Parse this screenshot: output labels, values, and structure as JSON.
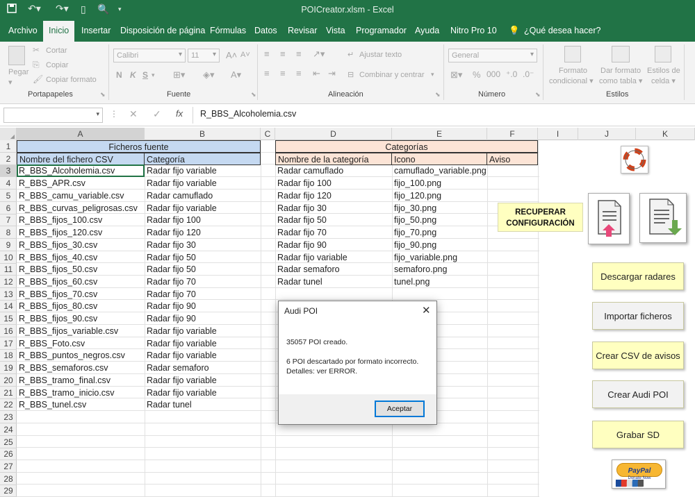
{
  "window": {
    "title": "POICreator.xlsm  -  Excel"
  },
  "ribbon_tabs": [
    "Archivo",
    "Inicio",
    "Insertar",
    "Disposición de página",
    "Fórmulas",
    "Datos",
    "Revisar",
    "Vista",
    "Programador",
    "Ayuda",
    "Nitro Pro 10",
    "¿Qué desea hacer?"
  ],
  "ribbon": {
    "paste": "Pegar",
    "cut": "Cortar",
    "copy": "Copiar",
    "format_painter": "Copiar formato",
    "font_name": "Calibri",
    "font_size": "11",
    "bold": "N",
    "italic": "K",
    "underline": "S",
    "wrap": "Ajustar texto",
    "merge": "Combinar y centrar",
    "number_format": "General",
    "cond_format": [
      "Formato",
      "condicional ▾"
    ],
    "format_table": [
      "Dar formato",
      "como tabla ▾"
    ],
    "cell_styles": [
      "Estilos de",
      "celda ▾"
    ],
    "groups": {
      "clipboard": "Portapapeles",
      "font": "Fuente",
      "alignment": "Alineación",
      "number": "Número",
      "styles": "Estilos"
    }
  },
  "formula_bar": {
    "content": "R_BBS_Alcoholemia.csv",
    "fx": "fx"
  },
  "columns": [
    "A",
    "B",
    "C",
    "D",
    "E",
    "F",
    "I",
    "J",
    "K"
  ],
  "rows": [
    "1",
    "2",
    "3",
    "4",
    "5",
    "6",
    "7",
    "8",
    "9",
    "10",
    "11",
    "12",
    "13",
    "14",
    "15",
    "16",
    "17",
    "18",
    "19",
    "20",
    "21",
    "22",
    "23",
    "24",
    "25",
    "26",
    "27",
    "28",
    "29"
  ],
  "sheet": {
    "fuente_title": "Ficheros fuente",
    "fuente_headers": [
      "Nombre del fichero CSV",
      "Categoría"
    ],
    "fuente_rows": [
      [
        "R_BBS_Alcoholemia.csv",
        "Radar fijo variable"
      ],
      [
        "R_BBS_APR.csv",
        "Radar fijo variable"
      ],
      [
        "R_BBS_camu_variable.csv",
        "Radar camuflado"
      ],
      [
        "R_BBS_curvas_peligrosas.csv",
        "Radar fijo variable"
      ],
      [
        "R_BBS_fijos_100.csv",
        "Radar fijo 100"
      ],
      [
        "R_BBS_fijos_120.csv",
        "Radar fijo 120"
      ],
      [
        "R_BBS_fijos_30.csv",
        "Radar fijo 30"
      ],
      [
        "R_BBS_fijos_40.csv",
        "Radar fijo 50"
      ],
      [
        "R_BBS_fijos_50.csv",
        "Radar fijo 50"
      ],
      [
        "R_BBS_fijos_60.csv",
        "Radar fijo 70"
      ],
      [
        "R_BBS_fijos_70.csv",
        "Radar fijo 70"
      ],
      [
        "R_BBS_fijos_80.csv",
        "Radar fijo 90"
      ],
      [
        "R_BBS_fijos_90.csv",
        "Radar fijo 90"
      ],
      [
        "R_BBS_fijos_variable.csv",
        "Radar fijo variable"
      ],
      [
        "R_BBS_Foto.csv",
        "Radar fijo variable"
      ],
      [
        "R_BBS_puntos_negros.csv",
        "Radar fijo variable"
      ],
      [
        "R_BBS_semaforos.csv",
        "Radar semaforo"
      ],
      [
        "R_BBS_tramo_final.csv",
        "Radar fijo variable"
      ],
      [
        "R_BBS_tramo_inicio.csv",
        "Radar fijo variable"
      ],
      [
        "R_BBS_tunel.csv",
        "Radar tunel"
      ]
    ],
    "cat_title": "Categorías",
    "cat_headers": [
      "Nombre de la categoría",
      "Icono",
      "Aviso"
    ],
    "cat_rows": [
      [
        "Radar camuflado",
        "camuflado_variable.png"
      ],
      [
        "Radar fijo 100",
        "fijo_100.png"
      ],
      [
        "Radar fijo 120",
        "fijo_120.png"
      ],
      [
        "Radar fijo 30",
        "fijo_30.png"
      ],
      [
        "Radar fijo 50",
        "fijo_50.png"
      ],
      [
        "Radar fijo 70",
        "fijo_70.png"
      ],
      [
        "Radar fijo 90",
        "fijo_90.png"
      ],
      [
        "Radar fijo variable",
        "fijo_variable.png"
      ],
      [
        "Radar semaforo",
        "semaforo.png"
      ],
      [
        "Radar tunel",
        "tunel.png"
      ]
    ]
  },
  "buttons": {
    "recuperar": [
      "RECUPERAR",
      "CONFIGURACIÓN"
    ],
    "descargar": "Descargar radares",
    "importar": "Importar ficheros",
    "crear_csv": "Crear CSV de avisos",
    "crear_audi": "Crear Audi POI",
    "grabar": "Grabar SD",
    "paypal": "PayPal",
    "paypal_sub": "Donate Now"
  },
  "dialog": {
    "title": "Audi POI",
    "line1": "35057 POI creado.",
    "line2": "6 POI descartado por formato incorrecto.",
    "line3": "Detalles: ver ERROR.",
    "ok": "Aceptar"
  },
  "colors": {
    "excel_green": "#217346",
    "header_blue": "#c5d9f1",
    "header_peach": "#fce4d6",
    "button_yellow": "#ffffc0"
  }
}
